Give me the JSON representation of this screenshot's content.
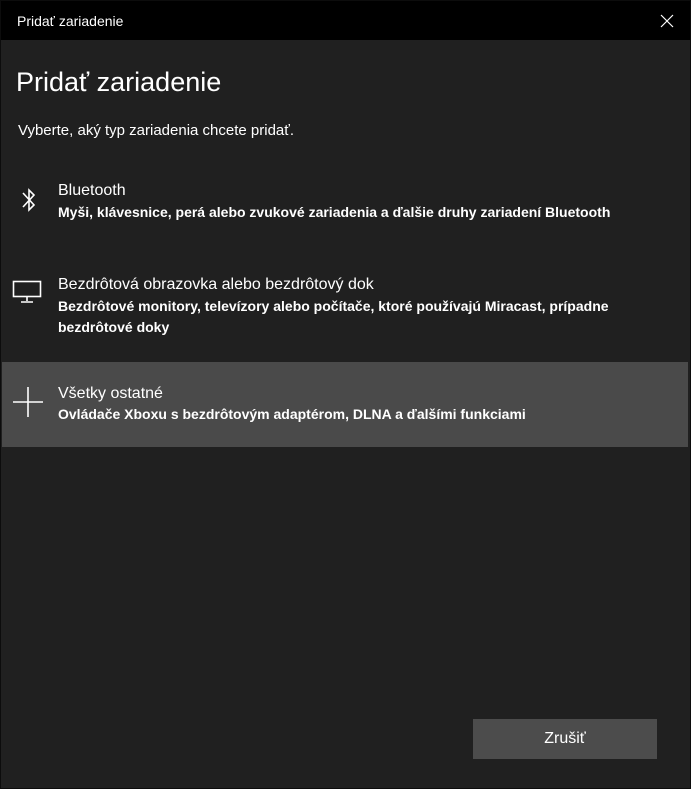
{
  "window": {
    "title": "Pridať zariadenie"
  },
  "header": {
    "title": "Pridať zariadenie",
    "subtitle": "Vyberte, aký typ zariadenia chcete pridať."
  },
  "options": [
    {
      "icon": "bluetooth-icon",
      "title": "Bluetooth",
      "description": "Myši, klávesnice, perá alebo zvukové zariadenia a ďalšie druhy zariadení Bluetooth",
      "selected": false
    },
    {
      "icon": "monitor-icon",
      "title": "Bezdrôtová obrazovka alebo bezdrôtový dok",
      "description": "Bezdrôtové monitory, televízory alebo počítače, ktoré používajú Miracast, prípadne bezdrôtové doky",
      "selected": false
    },
    {
      "icon": "plus-icon",
      "title": "Všetky ostatné",
      "description": "Ovládače Xboxu s bezdrôtovým adaptérom, DLNA a ďalšími funkciami",
      "selected": true
    }
  ],
  "footer": {
    "cancel_label": "Zrušiť"
  },
  "colors": {
    "titlebar": "#000000",
    "background": "#202020",
    "selected_option": "#4a4a4a",
    "button": "#4c4c4c",
    "text": "#ffffff"
  }
}
